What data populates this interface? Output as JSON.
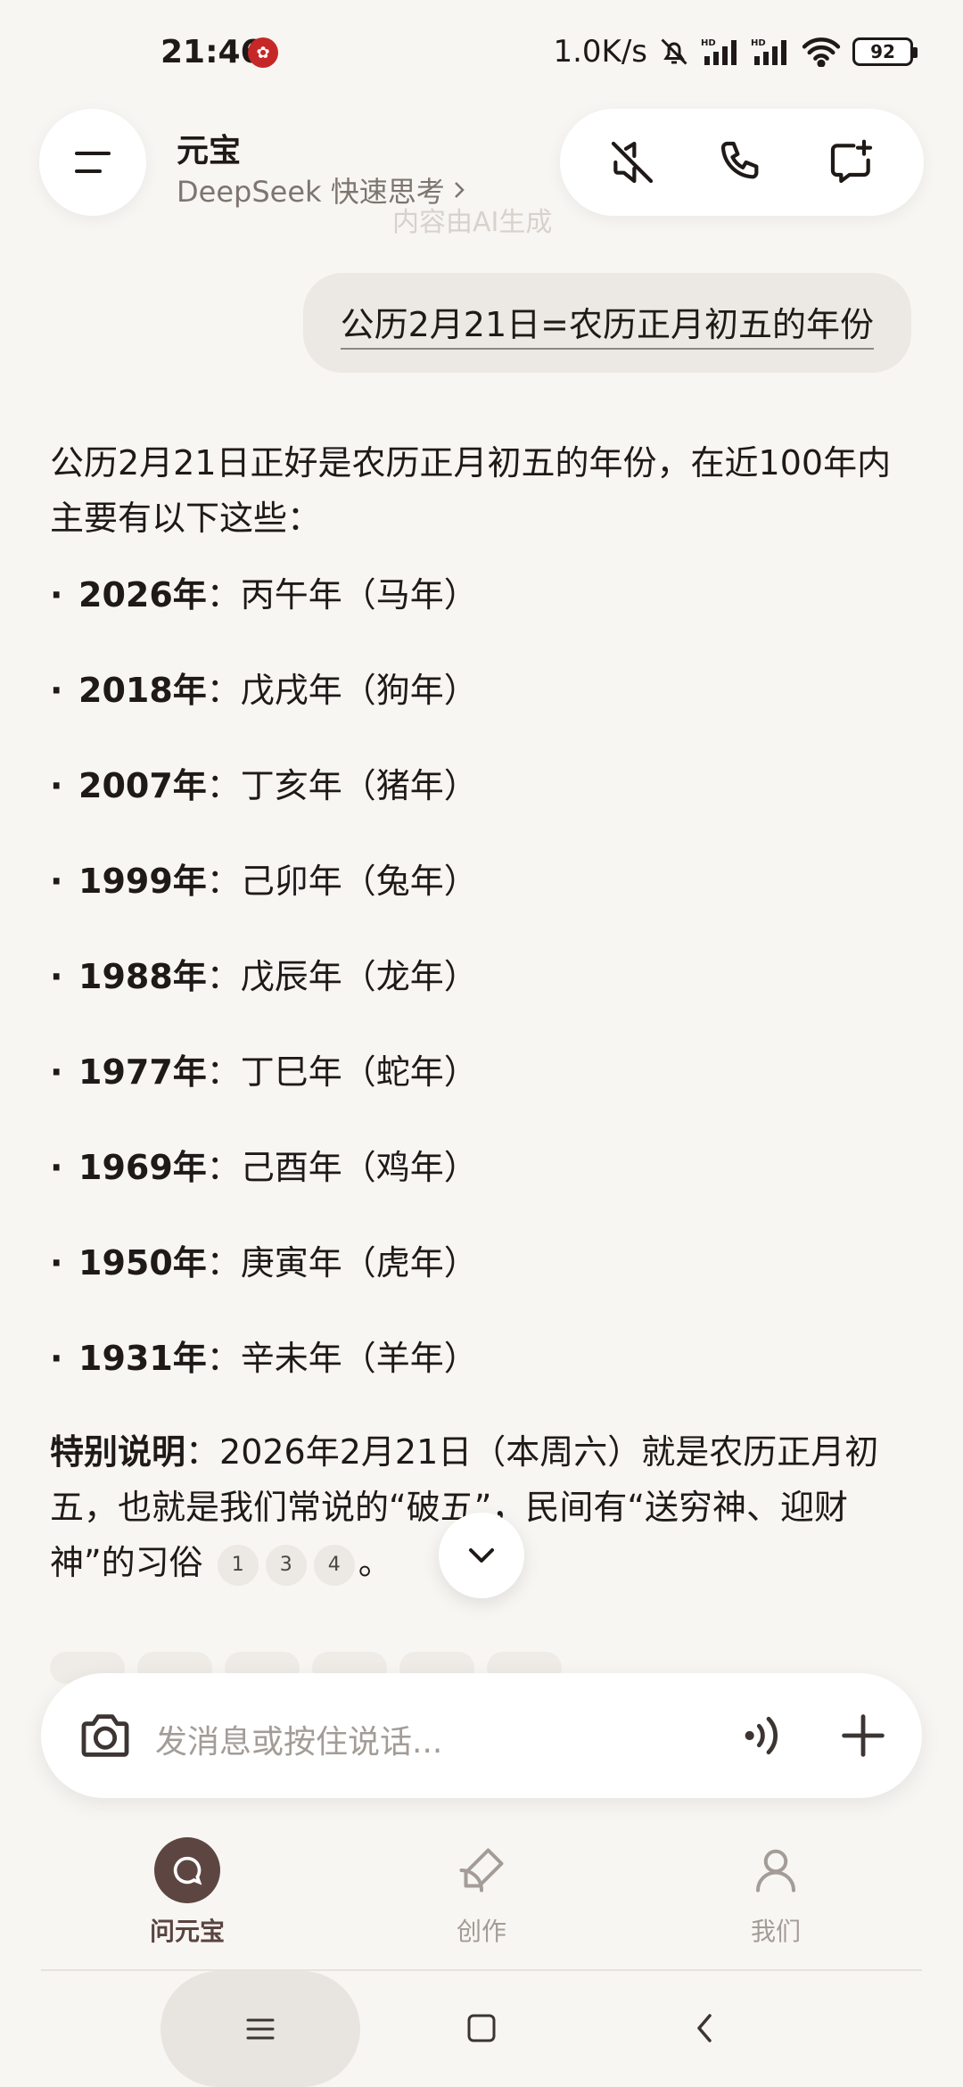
{
  "status_bar": {
    "time": "21:46",
    "net_speed": "1.0K/s",
    "battery": "92"
  },
  "header": {
    "title": "元宝",
    "subtitle": "DeepSeek 快速思考",
    "ghost_text": "内容由AI生成"
  },
  "user_message": "公历2月21日=农历正月初五的年份",
  "answer": {
    "intro": "公历2月21日正好是农历正月初五的年份，在近100年内主要有以下这些：",
    "items": [
      {
        "year": "2026年",
        "desc": "：丙午年（马年）"
      },
      {
        "year": "2018年",
        "desc": "：戊戌年（狗年）"
      },
      {
        "year": "2007年",
        "desc": "：丁亥年（猪年）"
      },
      {
        "year": "1999年",
        "desc": "：己卯年（兔年）"
      },
      {
        "year": "1988年",
        "desc": "：戊辰年（龙年）"
      },
      {
        "year": "1977年",
        "desc": "：丁巳年（蛇年）"
      },
      {
        "year": "1969年",
        "desc": "：己酉年（鸡年）"
      },
      {
        "year": "1950年",
        "desc": "：庚寅年（虎年）"
      },
      {
        "year": "1931年",
        "desc": "：辛未年（羊年）"
      }
    ],
    "note_label": "特别说明",
    "note_text": "：2026年2月21日（本周六）就是农历正月初五，也就是我们常说的“破五”，民间有“送穷神、迎财神”的习俗",
    "citations": [
      "1",
      "3",
      "4"
    ],
    "note_end": "。"
  },
  "input": {
    "placeholder": "发消息或按住说话..."
  },
  "bottom_nav": {
    "items": [
      {
        "label": "问元宝"
      },
      {
        "label": "创作"
      },
      {
        "label": "我们"
      }
    ]
  },
  "colors": {
    "background": "#f8f6f3",
    "accent": "#5d4642",
    "text": "#1f1a17",
    "muted": "#a39c97"
  }
}
